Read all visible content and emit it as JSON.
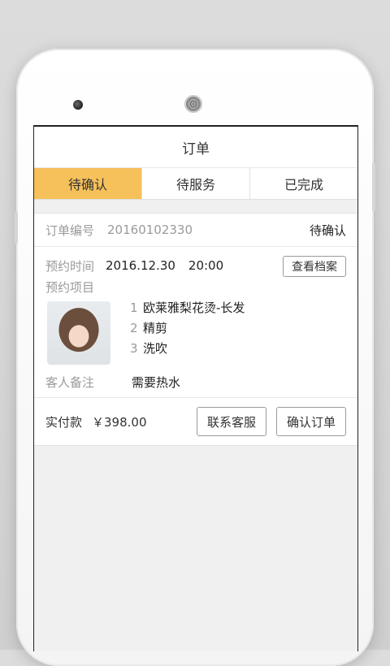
{
  "header": {
    "title": "订单"
  },
  "tabs": [
    {
      "label": "待确认",
      "active": true
    },
    {
      "label": "待服务",
      "active": false
    },
    {
      "label": "已完成",
      "active": false
    }
  ],
  "order": {
    "number_label": "订单编号",
    "number": "20160102330",
    "status": "待确认",
    "time_label": "预约时间",
    "date": "2016.12.30",
    "time": "20:00",
    "profile_button": "查看档案",
    "items_label": "预约项目",
    "items": [
      {
        "num": "1",
        "name": "欧莱雅梨花烫-长发"
      },
      {
        "num": "2",
        "name": "精剪"
      },
      {
        "num": "3",
        "name": "洗吹"
      }
    ],
    "note_label": "客人备注",
    "note": "需要热水"
  },
  "footer": {
    "pay_label": "实付款",
    "pay_amount": "￥398.00",
    "contact_button": "联系客服",
    "confirm_button": "确认订单"
  },
  "colors": {
    "accent": "#f6c05a"
  }
}
